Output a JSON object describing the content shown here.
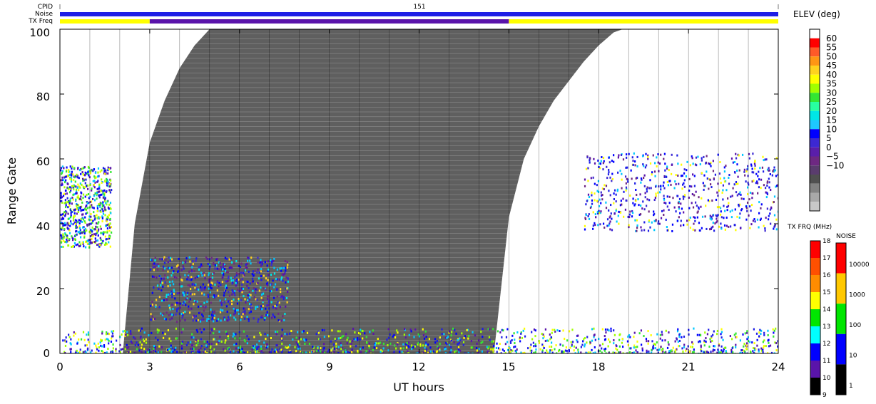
{
  "header": {
    "labels": [
      "CPID",
      "Noise",
      "TX Freq"
    ],
    "cpid_value": "151"
  },
  "chart_data": {
    "type": "heatmap",
    "xlabel": "UT hours",
    "ylabel": "Range Gate",
    "xlim": [
      0,
      24
    ],
    "ylim": [
      0,
      100
    ],
    "x_ticks": [
      "0",
      "3",
      "6",
      "9",
      "12",
      "15",
      "18",
      "21",
      "24"
    ],
    "y_ticks": [
      "0",
      "20",
      "40",
      "60",
      "80",
      "100"
    ],
    "grid": "vertical hourly lines",
    "ground_scatter_color": "#5f5f5f",
    "ground_scatter_edge": {
      "hours": [
        2.1,
        2.5,
        3.0,
        3.5,
        4.0,
        4.5,
        5.0,
        5.5,
        14.5,
        15.0,
        15.5,
        16.0,
        16.5,
        17.0,
        17.5,
        18.0,
        18.5,
        18.8
      ],
      "gates": [
        0,
        40,
        65,
        78,
        88,
        95,
        100,
        100,
        0,
        42,
        60,
        70,
        78,
        84,
        90,
        95,
        99,
        100
      ]
    },
    "elevation_colorbar": {
      "title": "ELEV (deg)",
      "ticks": [
        "60",
        "55",
        "50",
        "45",
        "40",
        "35",
        "30",
        "25",
        "20",
        "15",
        "10",
        "5",
        "0",
        "−5",
        "−10"
      ],
      "colors": [
        "#ffffff",
        "#ff0000",
        "#ff5a28",
        "#ff9614",
        "#ffd21e",
        "#ffff00",
        "#a0ff00",
        "#32e632",
        "#28ffa0",
        "#00e6e6",
        "#1ec8ff",
        "#0000ff",
        "#3c28d2",
        "#5a1eaa",
        "#6e2882",
        "#5a3c6e",
        "#505050",
        "#828282",
        "#a8a8a8",
        "#c8c8c8"
      ]
    },
    "tx_freq_colorbar": {
      "title": "TX FRQ (MHz)",
      "ticks": [
        "18",
        "17",
        "16",
        "15",
        "14",
        "13",
        "12",
        "11",
        "10",
        "9"
      ],
      "colors": [
        "#ff0000",
        "#ff5000",
        "#ff8c00",
        "#ffff00",
        "#00e600",
        "#00ffff",
        "#0000ff",
        "#5a14aa",
        "#000000"
      ]
    },
    "noise_colorbar": {
      "title": "NOISE",
      "ticks": [
        "10000",
        "1000",
        "100",
        "10",
        "1"
      ],
      "colors": [
        "#ff0000",
        "#ffc800",
        "#00e600",
        "#0000ff",
        "#000000"
      ]
    },
    "noise_bar_color": "#1e1ee6",
    "txfreq_bar": {
      "segments": [
        {
          "from": 0,
          "to": 3,
          "color": "#ffff00"
        },
        {
          "from": 3,
          "to": 15,
          "color": "#5a14aa"
        },
        {
          "from": 15,
          "to": 24,
          "color": "#ffff00"
        }
      ]
    },
    "scatter_regions": [
      {
        "name": "early-patch",
        "x": [
          0,
          1.7
        ],
        "y": [
          33,
          58
        ],
        "mix": "blue-green-yellow"
      },
      {
        "name": "morning-blob",
        "x": [
          3.0,
          7.6
        ],
        "y": [
          10,
          30
        ],
        "mix": "blue-cyan-purple"
      },
      {
        "name": "evening-patch",
        "x": [
          17.5,
          24
        ],
        "y": [
          38,
          62
        ],
        "mix": "blue-purple"
      },
      {
        "name": "low-band",
        "x": [
          0,
          24
        ],
        "y": [
          0,
          8
        ],
        "mix": "blue-green-yellow"
      }
    ]
  }
}
